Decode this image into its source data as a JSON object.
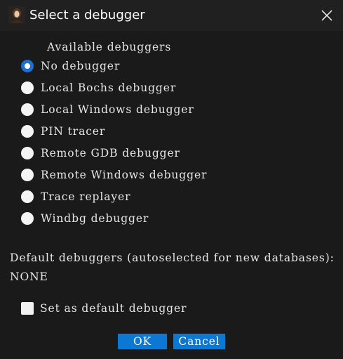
{
  "window": {
    "title": "Select a debugger",
    "accent_color": "#0c78d4"
  },
  "titlebar": {
    "icon": "app-portrait-icon",
    "close_icon": "close-icon"
  },
  "available": {
    "label": "Available debuggers",
    "selected_index": 0,
    "options": [
      {
        "label": "No debugger",
        "checked": true
      },
      {
        "label": "Local Bochs debugger",
        "checked": false
      },
      {
        "label": "Local Windows debugger",
        "checked": false
      },
      {
        "label": "PIN tracer",
        "checked": false
      },
      {
        "label": "Remote GDB debugger",
        "checked": false
      },
      {
        "label": "Remote Windows debugger",
        "checked": false
      },
      {
        "label": "Trace replayer",
        "checked": false
      },
      {
        "label": "Windbg debugger",
        "checked": false
      }
    ]
  },
  "defaults": {
    "label": "Default debuggers (autoselected for new databases):",
    "value": "NONE"
  },
  "set_default": {
    "label": "Set as default debugger",
    "checked": false
  },
  "buttons": {
    "ok": "OK",
    "cancel": "Cancel"
  }
}
